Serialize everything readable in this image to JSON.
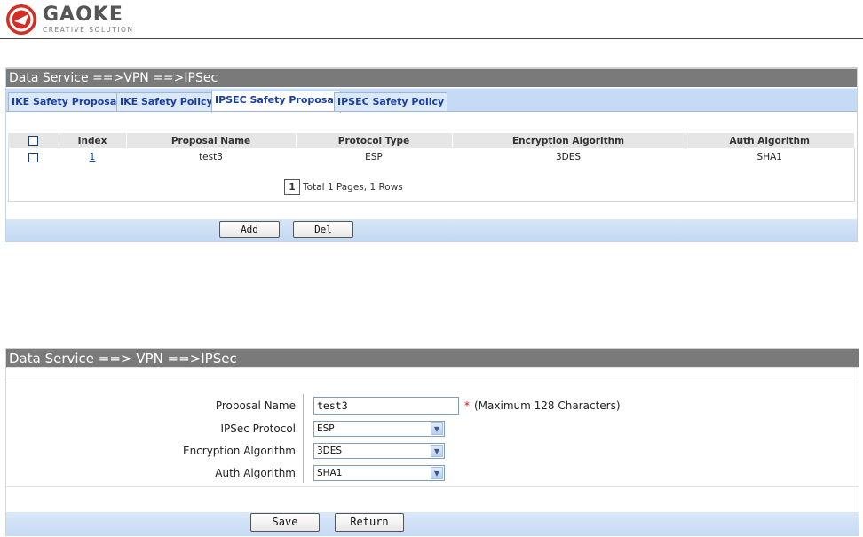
{
  "header": {
    "brand": "GAOKE",
    "tagline": "CREATIVE SOLUTION"
  },
  "list_panel": {
    "title": "Data Service ==>VPN ==>IPSec",
    "tabs": [
      {
        "label": "IKE Safety Proposal",
        "active": false
      },
      {
        "label": "IKE Safety Policy",
        "active": false
      },
      {
        "label": "IPSEC Safety Proposal",
        "active": true
      },
      {
        "label": "IPSEC Safety Policy",
        "active": false
      }
    ],
    "columns": [
      "Index",
      "Proposal Name",
      "Protocol Type",
      "Encryption Algorithm",
      "Auth Algorithm"
    ],
    "rows": [
      {
        "index": "1",
        "name": "test3",
        "protocol": "ESP",
        "encryption": "3DES",
        "auth": "SHA1"
      }
    ],
    "pager": {
      "current": "1",
      "summary": "Total 1 Pages, 1 Rows"
    },
    "buttons": {
      "add": "Add",
      "del": "Del"
    }
  },
  "edit_panel": {
    "title": "Data Service ==> VPN ==>IPSec",
    "fields": {
      "proposal_name": {
        "label": "Proposal Name",
        "value": "test3",
        "required_mark": "*",
        "hint": "(Maximum 128 Characters)"
      },
      "ipsec_protocol": {
        "label": "IPSec Protocol",
        "value": "ESP"
      },
      "encryption_algorithm": {
        "label": "Encryption Algorithm",
        "value": "3DES"
      },
      "auth_algorithm": {
        "label": "Auth Algorithm",
        "value": "SHA1"
      }
    },
    "buttons": {
      "save": "Save",
      "return": "Return"
    }
  },
  "colors": {
    "title_bar": "#7a7a7a",
    "tab_bar": "#c5dbf5",
    "tab_text": "#1a3e9e",
    "required": "#d01010"
  },
  "icons": {
    "logo": "gaoke-logo-icon",
    "select_arrow": "chevron-down-icon",
    "checkbox": "checkbox-icon"
  }
}
